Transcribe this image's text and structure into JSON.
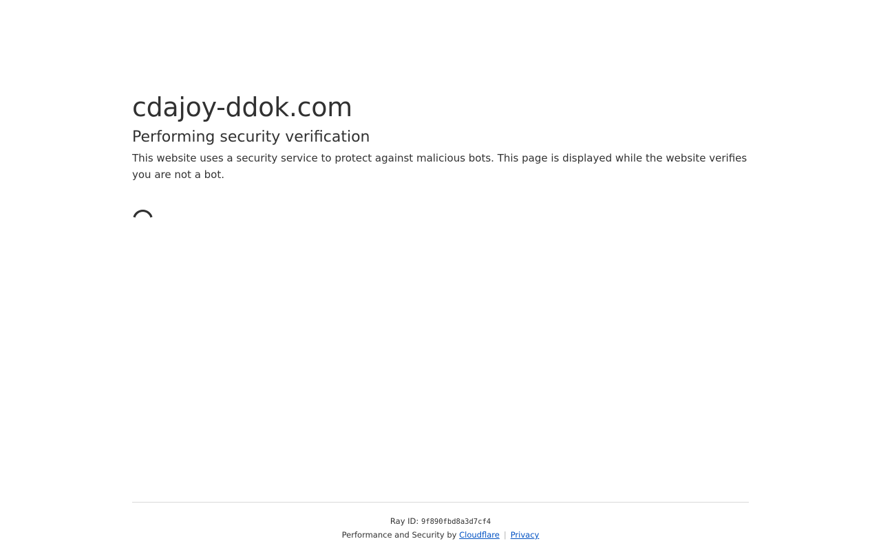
{
  "page": {
    "domain": "cdajoy-ddok.com",
    "heading": "Performing security verification",
    "description": "This website uses a security service to protect against malicious bots. This page is displayed while the website verifies you are not a bot.",
    "spinner_icon": "loading-spinner-icon"
  },
  "footer": {
    "ray_label": "Ray ID:",
    "ray_id": "9f890fbd8a3d7cf4",
    "performance_text": "Performance and Security by",
    "cloudflare_link": "Cloudflare",
    "separator": "|",
    "privacy_link": "Privacy"
  },
  "colors": {
    "text": "#313131",
    "link": "#0051c3",
    "divider": "#d9d9d9"
  }
}
